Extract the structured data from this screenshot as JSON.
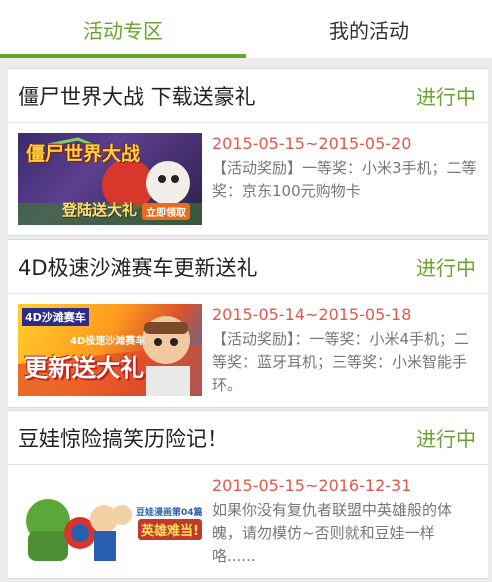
{
  "tabs": [
    {
      "label": "活动专区",
      "active": true
    },
    {
      "label": "我的活动",
      "active": false
    }
  ],
  "colors": {
    "accent": "#6aa42f",
    "date": "#e2594b",
    "desc": "#777777",
    "background": "#ececec"
  },
  "activities": [
    {
      "title": "僵尸世界大战 下载送豪礼",
      "status": "进行中",
      "date": "2015-05-15~2015-05-20",
      "description": "【活动奖励】一等奖：小米3手机；二等奖：京东100元购物卡",
      "image": {
        "icon": "zombie-world-war-banner",
        "text_main": "僵尸世界大战",
        "text_sub": "登陆送大礼",
        "text_btn": "立即领取"
      }
    },
    {
      "title": "4D极速沙滩赛车更新送礼",
      "status": "进行中",
      "date": "2015-05-14~2015-05-18",
      "description": "【活动奖励】：一等奖：小米4手机；二等奖：蓝牙耳机；三等奖：小米智能手环。",
      "image": {
        "icon": "beach-racing-banner",
        "text_logo": "4D沙滩赛车",
        "text_main": "更新送大礼",
        "text_sub": "4D极速沙滩赛车"
      }
    },
    {
      "title": "豆娃惊险搞笑历险记！",
      "status": "进行中",
      "date": "2015-05-15~2016-12-31",
      "description": "如果你没有复仇者联盟中英雄般的体魄，请勿模仿~否则就和豆娃一样咯......",
      "image": {
        "icon": "douwa-comic-banner",
        "text_sub": "豆娃漫画第04篇",
        "text_main": "英雄难当!"
      }
    }
  ]
}
